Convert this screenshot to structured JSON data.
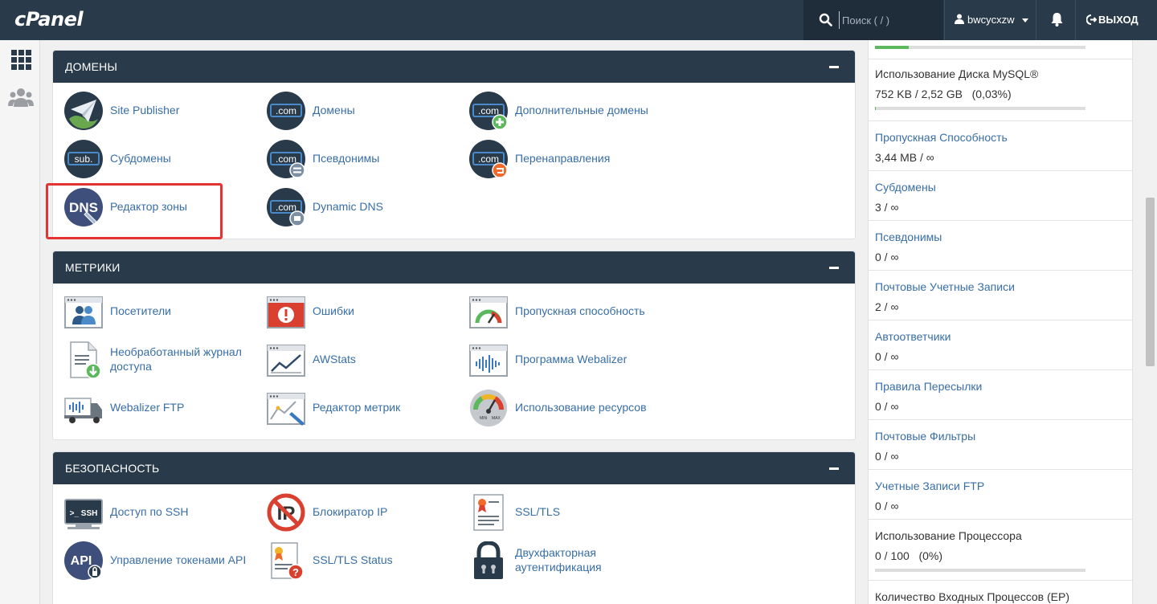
{
  "header": {
    "logo": "cPanel",
    "search_placeholder": "Поиск ( / )",
    "username": "bwcycxzw",
    "logout": "ВЫХОД"
  },
  "sections": [
    {
      "title": "ДОМЕНЫ",
      "items": [
        {
          "label": "Site Publisher",
          "icon": "paper-plane-icon"
        },
        {
          "label": "Домены",
          "icon": "dotcom-icon"
        },
        {
          "label": "Дополнительные домены",
          "icon": "dotcom-add-icon"
        },
        {
          "label": "Субдомены",
          "icon": "subdomain-icon"
        },
        {
          "label": "Псевдонимы",
          "icon": "dotcom-alias-icon"
        },
        {
          "label": "Перенаправления",
          "icon": "dotcom-redirect-icon"
        },
        {
          "label": "Редактор зоны",
          "icon": "dns-icon"
        },
        {
          "label": "Dynamic DNS",
          "icon": "dotcom-dynamic-icon"
        }
      ]
    },
    {
      "title": "МЕТРИКИ",
      "items": [
        {
          "label": "Посетители",
          "icon": "visitors-icon"
        },
        {
          "label": "Ошибки",
          "icon": "errors-icon"
        },
        {
          "label": "Пропускная способность",
          "icon": "bandwidth-gauge-icon"
        },
        {
          "label": "Необработанный журнал доступа",
          "icon": "raw-log-icon"
        },
        {
          "label": "AWStats",
          "icon": "awstats-icon"
        },
        {
          "label": "Программа Webalizer",
          "icon": "webalizer-icon"
        },
        {
          "label": "Webalizer FTP",
          "icon": "webalizer-ftp-icon"
        },
        {
          "label": "Редактор метрик",
          "icon": "metrics-editor-icon"
        },
        {
          "label": "Использование ресурсов",
          "icon": "resource-usage-icon"
        }
      ]
    },
    {
      "title": "БЕЗОПАСНОСТЬ",
      "items": [
        {
          "label": "Доступ по SSH",
          "icon": "ssh-terminal-icon"
        },
        {
          "label": "Блокиратор IP",
          "icon": "ip-blocker-icon"
        },
        {
          "label": "SSL/TLS",
          "icon": "ssl-certificate-icon"
        },
        {
          "label": "Управление токенами API",
          "icon": "api-token-icon"
        },
        {
          "label": "SSL/TLS Status",
          "icon": "ssl-status-icon"
        },
        {
          "label": "Двухфакторная аутентификация",
          "icon": "padlock-icon"
        }
      ]
    }
  ],
  "icon_text": {
    "com": ".com",
    "sub": "sub.",
    "dns": "DNS",
    "ssh": ">_ SSH",
    "api": "API",
    "ip": "IP",
    "min": "MIN",
    "max": "MAX"
  },
  "stats": [
    {
      "label": "",
      "value": "",
      "bar": 0.16,
      "link": false
    },
    {
      "label": "Использование Диска MySQL®",
      "value": "752 KB / 2,52 GB   (0,03%)",
      "bar": 0.003,
      "link": false
    },
    {
      "label": "Пропускная Способность",
      "value": "3,44 MB / ∞",
      "link": true
    },
    {
      "label": "Субдомены",
      "value": "3 / ∞",
      "link": true
    },
    {
      "label": "Псевдонимы",
      "value": "0 / ∞",
      "link": true
    },
    {
      "label": "Почтовые Учетные Записи",
      "value": "2 / ∞",
      "link": true
    },
    {
      "label": "Автоответчики",
      "value": "0 / ∞",
      "link": true
    },
    {
      "label": "Правила Пересылки",
      "value": "0 / ∞",
      "link": true
    },
    {
      "label": "Почтовые Фильтры",
      "value": "0 / ∞",
      "link": true
    },
    {
      "label": "Учетные Записи FTP",
      "value": "0 / ∞",
      "link": true
    },
    {
      "label": "Использование Процессора",
      "value": "0 / 100   (0%)",
      "bar": 0,
      "link": false
    },
    {
      "label": "Количество Входных Процессов (EP)",
      "value": "",
      "link": false
    }
  ]
}
